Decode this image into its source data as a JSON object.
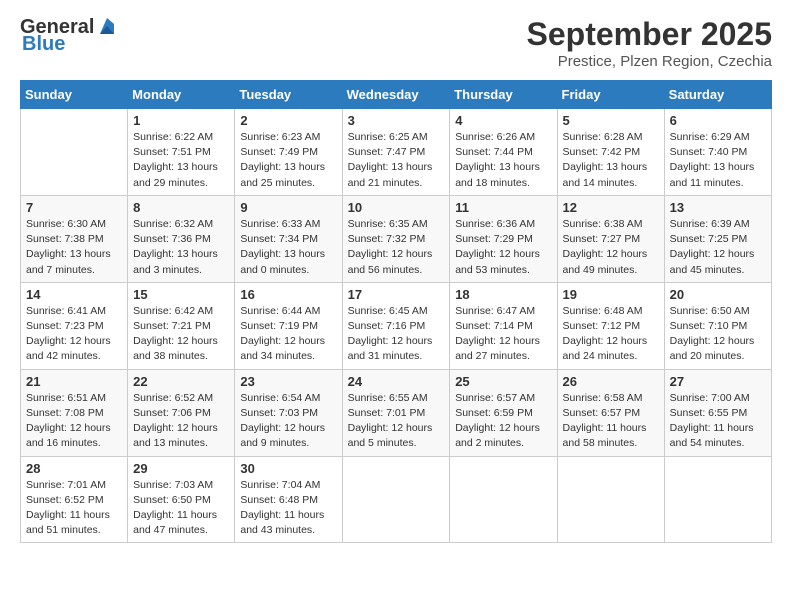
{
  "header": {
    "logo_general": "General",
    "logo_blue": "Blue",
    "month": "September 2025",
    "location": "Prestice, Plzen Region, Czechia"
  },
  "days_of_week": [
    "Sunday",
    "Monday",
    "Tuesday",
    "Wednesday",
    "Thursday",
    "Friday",
    "Saturday"
  ],
  "weeks": [
    [
      {
        "day": "",
        "info": ""
      },
      {
        "day": "1",
        "info": "Sunrise: 6:22 AM\nSunset: 7:51 PM\nDaylight: 13 hours\nand 29 minutes."
      },
      {
        "day": "2",
        "info": "Sunrise: 6:23 AM\nSunset: 7:49 PM\nDaylight: 13 hours\nand 25 minutes."
      },
      {
        "day": "3",
        "info": "Sunrise: 6:25 AM\nSunset: 7:47 PM\nDaylight: 13 hours\nand 21 minutes."
      },
      {
        "day": "4",
        "info": "Sunrise: 6:26 AM\nSunset: 7:44 PM\nDaylight: 13 hours\nand 18 minutes."
      },
      {
        "day": "5",
        "info": "Sunrise: 6:28 AM\nSunset: 7:42 PM\nDaylight: 13 hours\nand 14 minutes."
      },
      {
        "day": "6",
        "info": "Sunrise: 6:29 AM\nSunset: 7:40 PM\nDaylight: 13 hours\nand 11 minutes."
      }
    ],
    [
      {
        "day": "7",
        "info": "Sunrise: 6:30 AM\nSunset: 7:38 PM\nDaylight: 13 hours\nand 7 minutes."
      },
      {
        "day": "8",
        "info": "Sunrise: 6:32 AM\nSunset: 7:36 PM\nDaylight: 13 hours\nand 3 minutes."
      },
      {
        "day": "9",
        "info": "Sunrise: 6:33 AM\nSunset: 7:34 PM\nDaylight: 13 hours\nand 0 minutes."
      },
      {
        "day": "10",
        "info": "Sunrise: 6:35 AM\nSunset: 7:32 PM\nDaylight: 12 hours\nand 56 minutes."
      },
      {
        "day": "11",
        "info": "Sunrise: 6:36 AM\nSunset: 7:29 PM\nDaylight: 12 hours\nand 53 minutes."
      },
      {
        "day": "12",
        "info": "Sunrise: 6:38 AM\nSunset: 7:27 PM\nDaylight: 12 hours\nand 49 minutes."
      },
      {
        "day": "13",
        "info": "Sunrise: 6:39 AM\nSunset: 7:25 PM\nDaylight: 12 hours\nand 45 minutes."
      }
    ],
    [
      {
        "day": "14",
        "info": "Sunrise: 6:41 AM\nSunset: 7:23 PM\nDaylight: 12 hours\nand 42 minutes."
      },
      {
        "day": "15",
        "info": "Sunrise: 6:42 AM\nSunset: 7:21 PM\nDaylight: 12 hours\nand 38 minutes."
      },
      {
        "day": "16",
        "info": "Sunrise: 6:44 AM\nSunset: 7:19 PM\nDaylight: 12 hours\nand 34 minutes."
      },
      {
        "day": "17",
        "info": "Sunrise: 6:45 AM\nSunset: 7:16 PM\nDaylight: 12 hours\nand 31 minutes."
      },
      {
        "day": "18",
        "info": "Sunrise: 6:47 AM\nSunset: 7:14 PM\nDaylight: 12 hours\nand 27 minutes."
      },
      {
        "day": "19",
        "info": "Sunrise: 6:48 AM\nSunset: 7:12 PM\nDaylight: 12 hours\nand 24 minutes."
      },
      {
        "day": "20",
        "info": "Sunrise: 6:50 AM\nSunset: 7:10 PM\nDaylight: 12 hours\nand 20 minutes."
      }
    ],
    [
      {
        "day": "21",
        "info": "Sunrise: 6:51 AM\nSunset: 7:08 PM\nDaylight: 12 hours\nand 16 minutes."
      },
      {
        "day": "22",
        "info": "Sunrise: 6:52 AM\nSunset: 7:06 PM\nDaylight: 12 hours\nand 13 minutes."
      },
      {
        "day": "23",
        "info": "Sunrise: 6:54 AM\nSunset: 7:03 PM\nDaylight: 12 hours\nand 9 minutes."
      },
      {
        "day": "24",
        "info": "Sunrise: 6:55 AM\nSunset: 7:01 PM\nDaylight: 12 hours\nand 5 minutes."
      },
      {
        "day": "25",
        "info": "Sunrise: 6:57 AM\nSunset: 6:59 PM\nDaylight: 12 hours\nand 2 minutes."
      },
      {
        "day": "26",
        "info": "Sunrise: 6:58 AM\nSunset: 6:57 PM\nDaylight: 11 hours\nand 58 minutes."
      },
      {
        "day": "27",
        "info": "Sunrise: 7:00 AM\nSunset: 6:55 PM\nDaylight: 11 hours\nand 54 minutes."
      }
    ],
    [
      {
        "day": "28",
        "info": "Sunrise: 7:01 AM\nSunset: 6:52 PM\nDaylight: 11 hours\nand 51 minutes."
      },
      {
        "day": "29",
        "info": "Sunrise: 7:03 AM\nSunset: 6:50 PM\nDaylight: 11 hours\nand 47 minutes."
      },
      {
        "day": "30",
        "info": "Sunrise: 7:04 AM\nSunset: 6:48 PM\nDaylight: 11 hours\nand 43 minutes."
      },
      {
        "day": "",
        "info": ""
      },
      {
        "day": "",
        "info": ""
      },
      {
        "day": "",
        "info": ""
      },
      {
        "day": "",
        "info": ""
      }
    ]
  ]
}
